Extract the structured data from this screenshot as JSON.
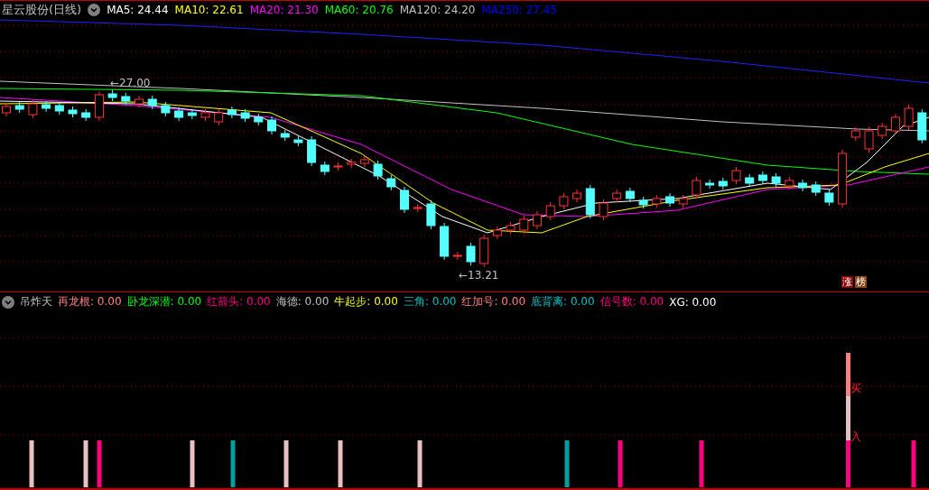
{
  "header": {
    "title": "星云股份(日线)",
    "indicators": [
      {
        "label": "MA5: 24.44",
        "color": "#ffffff"
      },
      {
        "label": "MA10: 22.61",
        "color": "#ffff00"
      },
      {
        "label": "MA20: 21.30",
        "color": "#ff00ff"
      },
      {
        "label": "MA60: 20.76",
        "color": "#00ff00"
      },
      {
        "label": "MA120: 24.20",
        "color": "#c0c0c0"
      },
      {
        "label": "MA250: 27.45",
        "color": "#0000ff"
      }
    ]
  },
  "price_chart": {
    "high_label": "←27.00",
    "low_label": "←13.21",
    "badges": [
      {
        "text": "涨",
        "color": "#8b0000"
      },
      {
        "text": "榜",
        "color": "#8b4513"
      }
    ]
  },
  "indicator_panel": {
    "name": "吊炸天",
    "values": [
      {
        "label": "再龙根:",
        "value": "0.00",
        "color": "#ff8080"
      },
      {
        "label": "卧龙深潜:",
        "value": "0.00",
        "color": "#00ff00"
      },
      {
        "label": "红箭头:",
        "value": "0.00",
        "color": "#ff0080"
      },
      {
        "label": "海德:",
        "value": "0.00",
        "color": "#c0c0c0"
      },
      {
        "label": "牛起步:",
        "value": "0.00",
        "color": "#ffff00"
      },
      {
        "label": "三角:",
        "value": "0.00",
        "color": "#00c0c0"
      },
      {
        "label": "红加号:",
        "value": "0.00",
        "color": "#ff8080"
      },
      {
        "label": "底背离:",
        "value": "0.00",
        "color": "#00c0c0"
      },
      {
        "label": "信号数:",
        "value": "0.00",
        "color": "#ff0080"
      },
      {
        "label": "XG:",
        "value": "0.00",
        "color": "#ffffff"
      }
    ]
  },
  "signal_chart": {
    "markers": [
      "买",
      "入"
    ]
  }
}
